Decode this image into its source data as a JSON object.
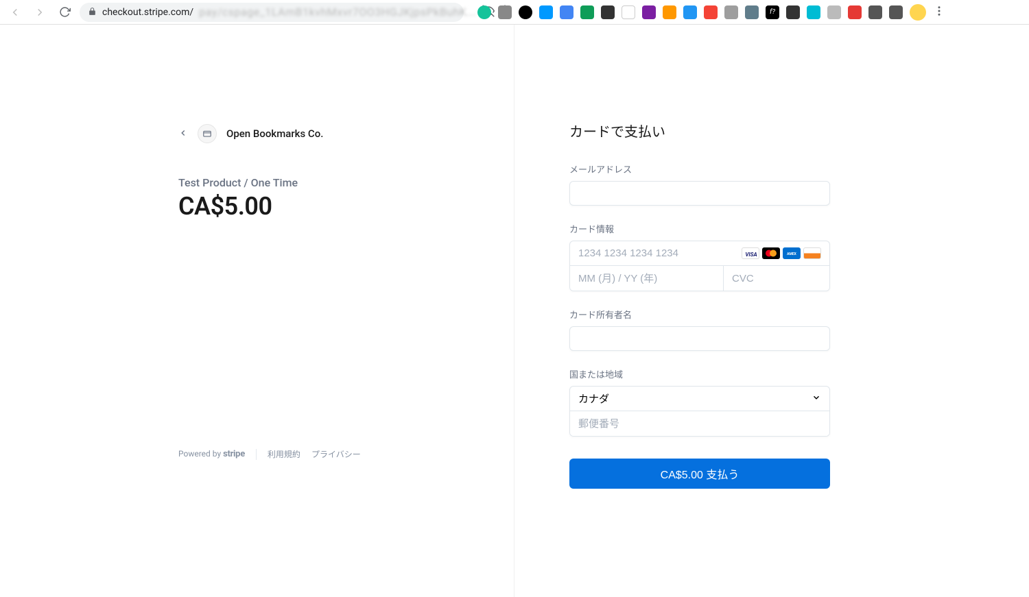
{
  "browser": {
    "url_domain": "checkout.stripe.com/",
    "url_blur": "pay/cspage_1LAmB1kvhMxvr7OO3HGJKjpsPkBuhK..."
  },
  "merchant": {
    "name": "Open Bookmarks Co."
  },
  "product": {
    "name": "Test Product / One Time",
    "price": "CA$5.00"
  },
  "footer": {
    "powered": "Powered by ",
    "stripe": "stripe",
    "terms": "利用規約",
    "privacy": "プライバシー"
  },
  "form": {
    "title": "カードで支払い",
    "email_label": "メールアドレス",
    "card_label": "カード情報",
    "card_number_placeholder": "1234 1234 1234 1234",
    "expiry_placeholder": "MM (月) / YY (年)",
    "cvc_placeholder": "CVC",
    "name_label": "カード所有者名",
    "country_label": "国または地域",
    "country_value": "カナダ",
    "postal_placeholder": "郵便番号",
    "pay_button": "CA$5.00 支払う"
  }
}
